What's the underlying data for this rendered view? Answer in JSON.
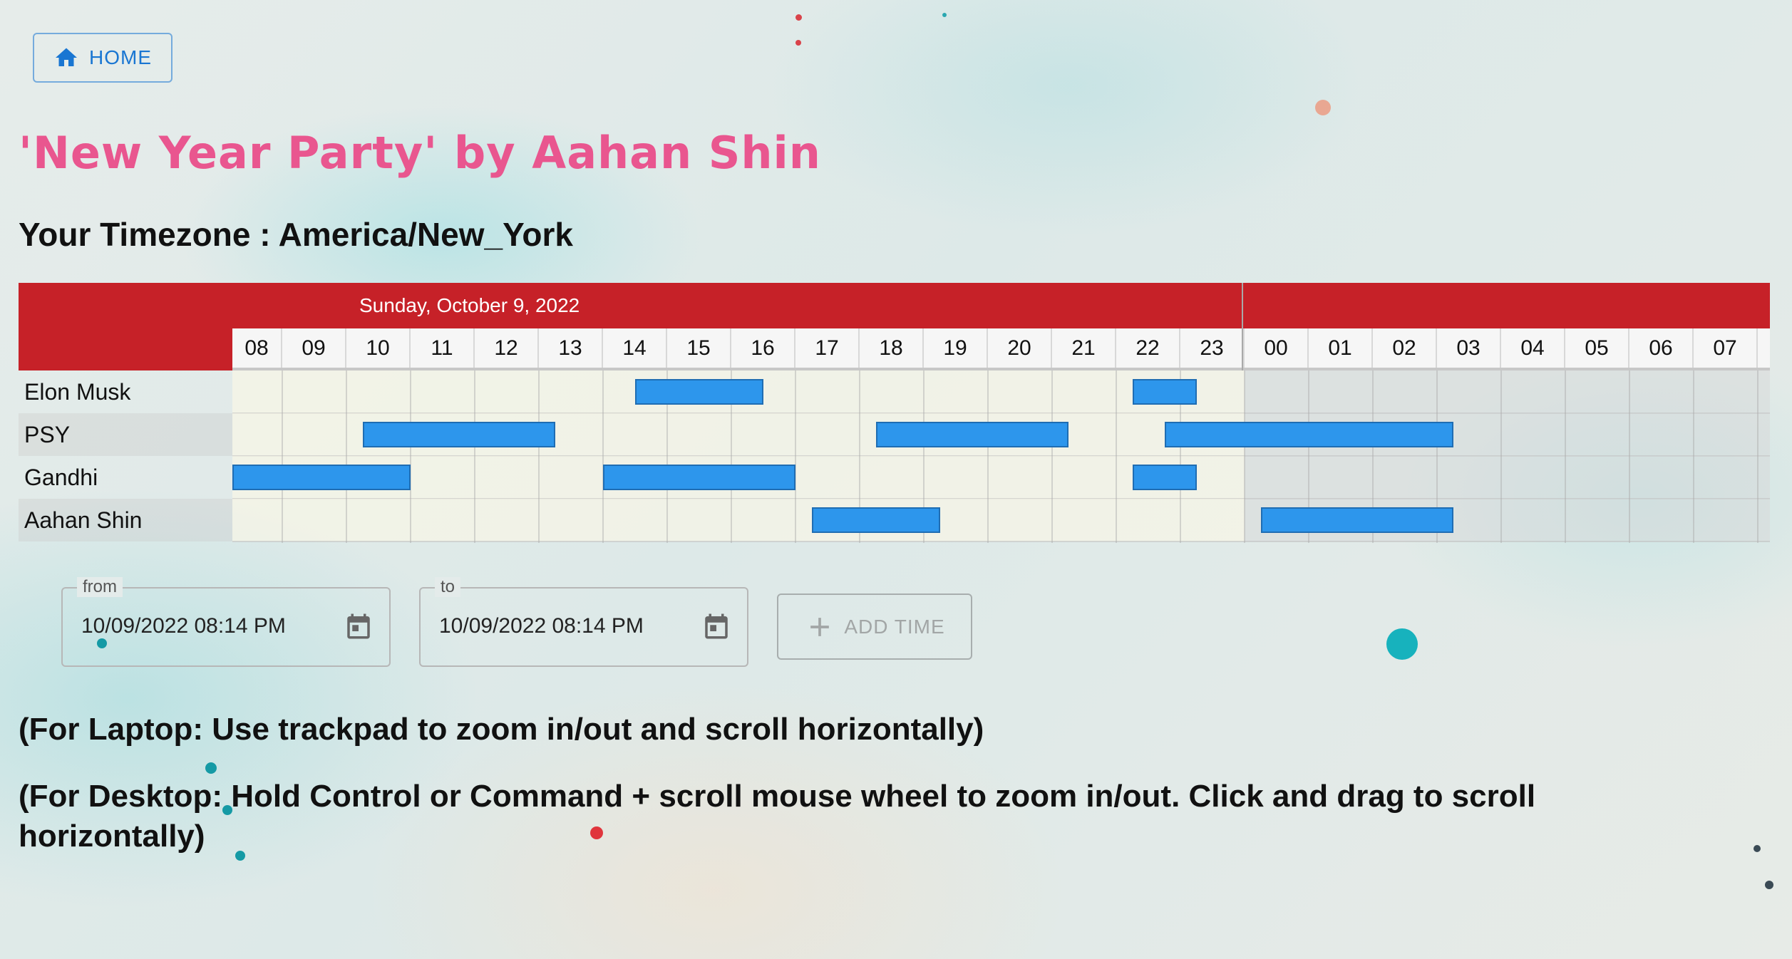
{
  "nav": {
    "home_label": "HOME"
  },
  "event": {
    "title": "'New Year Party' by Aahan Shin",
    "timezone_text": "Your Timezone : America/New_York"
  },
  "timeline": {
    "date_label": "Sunday, October 9, 2022",
    "next_date_label": "",
    "hours": [
      "08",
      "09",
      "10",
      "11",
      "12",
      "13",
      "14",
      "15",
      "16",
      "17",
      "18",
      "19",
      "20",
      "21",
      "22",
      "23",
      "00",
      "01",
      "02",
      "03",
      "04",
      "05",
      "06",
      "07"
    ],
    "participants": [
      {
        "name": "Elon Musk",
        "slots": [
          {
            "start": "14:30",
            "end": "16:30"
          },
          {
            "start": "22:15",
            "end": "23:15"
          }
        ]
      },
      {
        "name": "PSY",
        "slots": [
          {
            "start": "10:15",
            "end": "13:15"
          },
          {
            "start": "18:15",
            "end": "21:15"
          },
          {
            "start": "22:45",
            "end": "03:15"
          }
        ]
      },
      {
        "name": "Gandhi",
        "slots": [
          {
            "start": "08:00",
            "end": "11:00"
          },
          {
            "start": "14:00",
            "end": "17:00"
          },
          {
            "start": "22:15",
            "end": "23:15"
          }
        ]
      },
      {
        "name": "Aahan Shin",
        "slots": [
          {
            "start": "17:15",
            "end": "19:15"
          },
          {
            "start": "00:15",
            "end": "03:15"
          }
        ]
      }
    ],
    "colors": {
      "header": "#c62128",
      "slot": "#2d96ec"
    }
  },
  "form": {
    "from": {
      "legend": "from",
      "value": "10/09/2022 08:14 PM"
    },
    "to": {
      "legend": "to",
      "value": "10/09/2022 08:14 PM"
    },
    "add_time_label": "ADD TIME"
  },
  "hints": {
    "laptop": "(For Laptop: Use trackpad to zoom in/out and scroll horizontally)",
    "desktop": "(For Desktop: Hold Control or Command + scroll mouse wheel to zoom in/out. Click and drag to scroll horizontally)"
  }
}
